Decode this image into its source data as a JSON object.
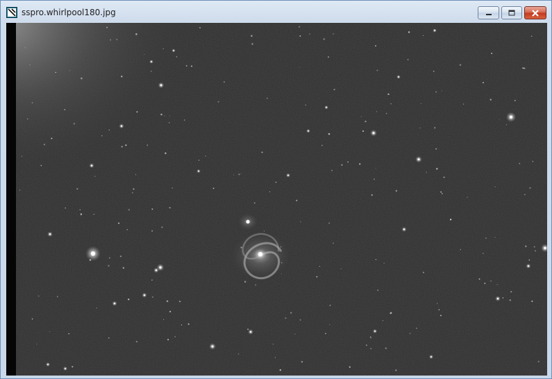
{
  "window": {
    "title": "sspro.whirlpool180.jpg",
    "icon": "sspro-app-icon",
    "controls": [
      {
        "name": "minimize",
        "icon": "minimize-icon"
      },
      {
        "name": "maximize",
        "icon": "maximize-icon"
      },
      {
        "name": "close",
        "icon": "close-icon"
      }
    ]
  },
  "image": {
    "subject": "astronomical image",
    "background_color": "#2d2d2d"
  }
}
